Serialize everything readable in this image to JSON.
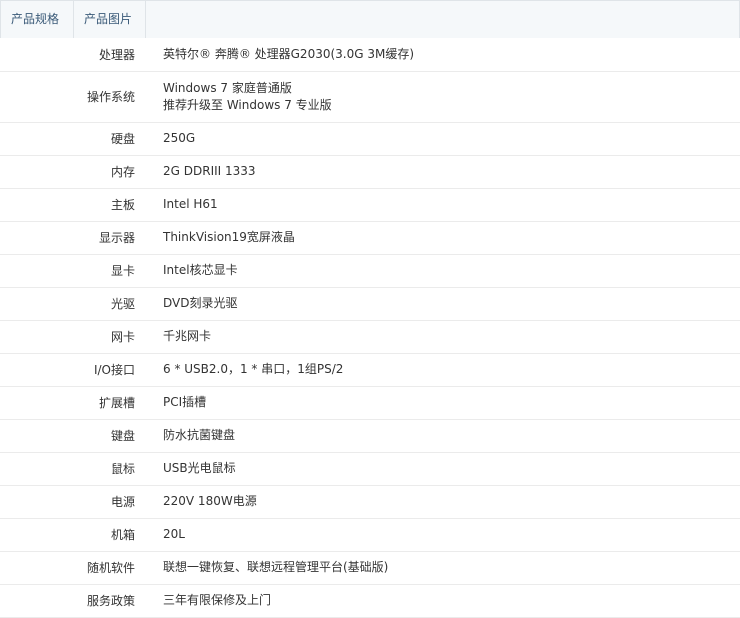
{
  "tabs": [
    {
      "label": "产品规格"
    },
    {
      "label": "产品图片"
    }
  ],
  "specs": [
    {
      "label": "处理器",
      "value": "英特尔® 奔腾® 处理器G2030(3.0G 3M缓存)"
    },
    {
      "label": "操作系统",
      "value": "Windows 7 家庭普通版",
      "value2": "推荐升级至 Windows 7 专业版"
    },
    {
      "label": "硬盘",
      "value": "250G"
    },
    {
      "label": "内存",
      "value": "2G DDRIII 1333"
    },
    {
      "label": "主板",
      "value": "Intel H61"
    },
    {
      "label": "显示器",
      "value": "ThinkVision19宽屏液晶"
    },
    {
      "label": "显卡",
      "value": "Intel核芯显卡"
    },
    {
      "label": "光驱",
      "value": "DVD刻录光驱"
    },
    {
      "label": "网卡",
      "value": "千兆网卡"
    },
    {
      "label": "I/O接口",
      "value": "6 * USB2.0，1 * 串口，1组PS/2"
    },
    {
      "label": "扩展槽",
      "value": "PCI插槽"
    },
    {
      "label": "键盘",
      "value": "防水抗菌键盘"
    },
    {
      "label": "鼠标",
      "value": "USB光电鼠标"
    },
    {
      "label": "电源",
      "value": "220V 180W电源"
    },
    {
      "label": "机箱",
      "value": "20L"
    },
    {
      "label": "随机软件",
      "value": "联想一键恢复、联想远程管理平台(基础版)"
    },
    {
      "label": "服务政策",
      "value": "三年有限保修及上门"
    }
  ]
}
